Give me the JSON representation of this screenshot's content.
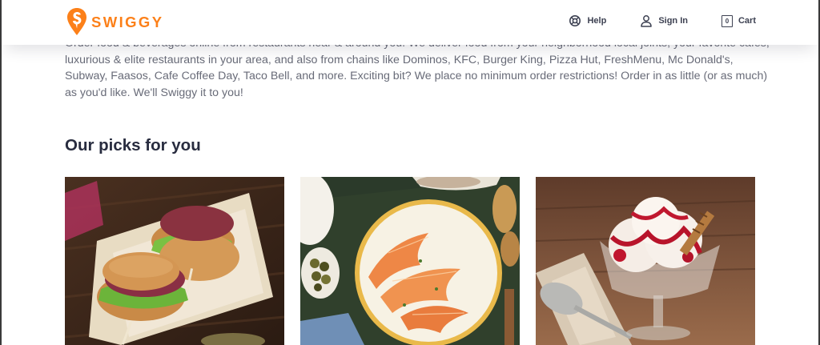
{
  "brand": {
    "name": "SWIGGY",
    "accent_color": "#fc8019"
  },
  "nav": {
    "help": {
      "label": "Help",
      "icon": "lifebuoy-icon"
    },
    "sign_in": {
      "label": "Sign In",
      "icon": "user-icon"
    },
    "cart": {
      "label": "Cart",
      "count": "0",
      "icon": "cart-icon"
    }
  },
  "intro_text": "Order food & beverages online from restaurants near & around you. We deliver food from your neighborhood local joints, your favorite cafes, luxurious & elite restaurants in your area, and also from chains like Dominos, KFC, Burger King, Pizza Hut, FreshMenu, Mc Donald's, Subway, Faasos, Cafe Coffee Day, Taco Bell, and more. Exciting bit? We place no minimum order restrictions! Order in as little (or as much) as you'd like. We'll Swiggy it to you!",
  "picks": {
    "title": "Our picks for you",
    "cards": [
      {
        "image": "burgers-photo"
      },
      {
        "image": "prawns-plate-photo"
      },
      {
        "image": "ice-cream-sundae-photo"
      }
    ]
  }
}
